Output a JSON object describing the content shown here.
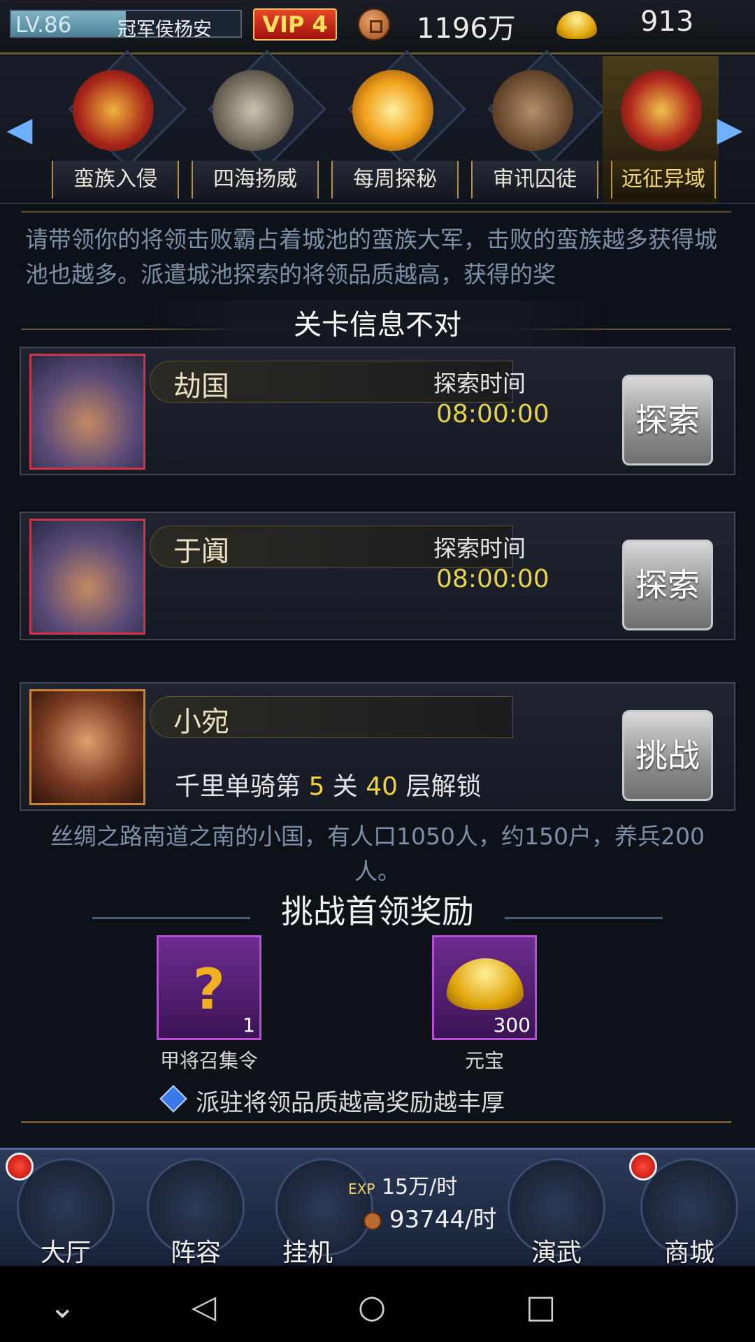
{
  "topbar": {
    "level": "LV.86",
    "player_name": "冠军侯杨安",
    "vip": "VIP 4",
    "coins": "1196万",
    "gold": "913"
  },
  "tabs": [
    {
      "label": "蛮族入侵"
    },
    {
      "label": "四海扬威"
    },
    {
      "label": "每周探秘"
    },
    {
      "label": "审讯囚徒"
    },
    {
      "label": "远征异域"
    }
  ],
  "description": "请带领你的将领击败霸占着城池的蛮族大军，击败的蛮族越多获得城池也越多。派遣城池探索的将领品质越高，获得的奖",
  "toast": "关卡信息不对",
  "stages": [
    {
      "name": "劫国",
      "time_label": "探索时间",
      "time": "08:00:00",
      "button": "探索"
    },
    {
      "name": "于阗",
      "time_label": "探索时间",
      "time": "08:00:00",
      "button": "探索"
    },
    {
      "name": "小宛",
      "unlock_prefix": "千里单骑第 ",
      "unlock_stage": "5",
      "unlock_mid": " 关 ",
      "unlock_floor": "40",
      "unlock_suffix": " 层解锁",
      "button": "挑战"
    }
  ],
  "stage_desc": "丝绸之路南道之南的小国，有人口1050人，约150户，养兵200人。",
  "rewards": {
    "title": "挑战首领奖励",
    "items": [
      {
        "name": "甲将召集令",
        "count": "1",
        "icon": "mystery-general-icon"
      },
      {
        "name": "元宝",
        "count": "300",
        "icon": "gold-ingot-icon"
      }
    ],
    "tip": "派驻将领品质越高奖励越丰厚"
  },
  "bottom_nav": {
    "items": [
      {
        "label": "大厅"
      },
      {
        "label": "阵容"
      },
      {
        "label": "挂机"
      },
      {
        "label": "演武"
      },
      {
        "label": "商城"
      }
    ],
    "exp_tag": "EXP",
    "exp_rate": "15万/时",
    "coin_rate": "93744/时"
  },
  "colors": {
    "accent_gold": "#e7d34a",
    "vip_red": "#c81b10",
    "badge_red": "#e02a1e"
  }
}
